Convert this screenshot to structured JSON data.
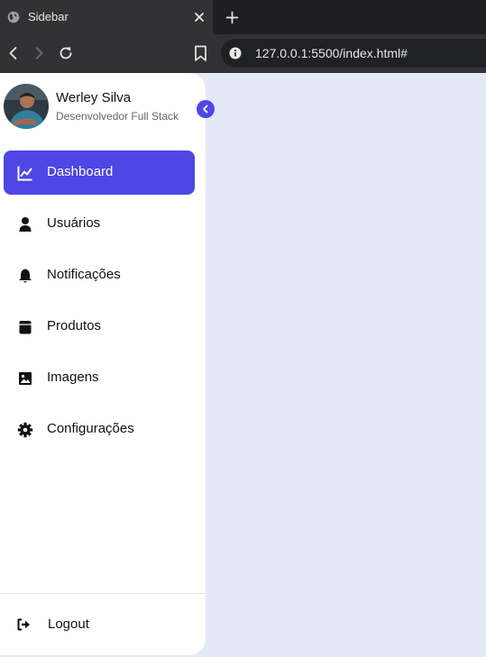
{
  "browser": {
    "tab_title": "Sidebar",
    "url": "127.0.0.1:5500/index.html#"
  },
  "profile": {
    "name": "Werley Silva",
    "role": "Desenvolvedor Full Stack"
  },
  "nav": {
    "items": [
      {
        "label": "Dashboard",
        "icon": "chart-line-icon",
        "active": true
      },
      {
        "label": "Usuários",
        "icon": "user-icon"
      },
      {
        "label": "Notificações",
        "icon": "bell-icon"
      },
      {
        "label": "Produtos",
        "icon": "box-icon"
      },
      {
        "label": "Imagens",
        "icon": "image-icon"
      },
      {
        "label": "Configurações",
        "icon": "gear-icon"
      }
    ]
  },
  "logout": {
    "label": "Logout",
    "icon": "sign-out-icon"
  },
  "colors": {
    "accent": "#4f46e5",
    "page_bg": "#e3e9f7",
    "sidebar_bg": "#ffffff"
  }
}
